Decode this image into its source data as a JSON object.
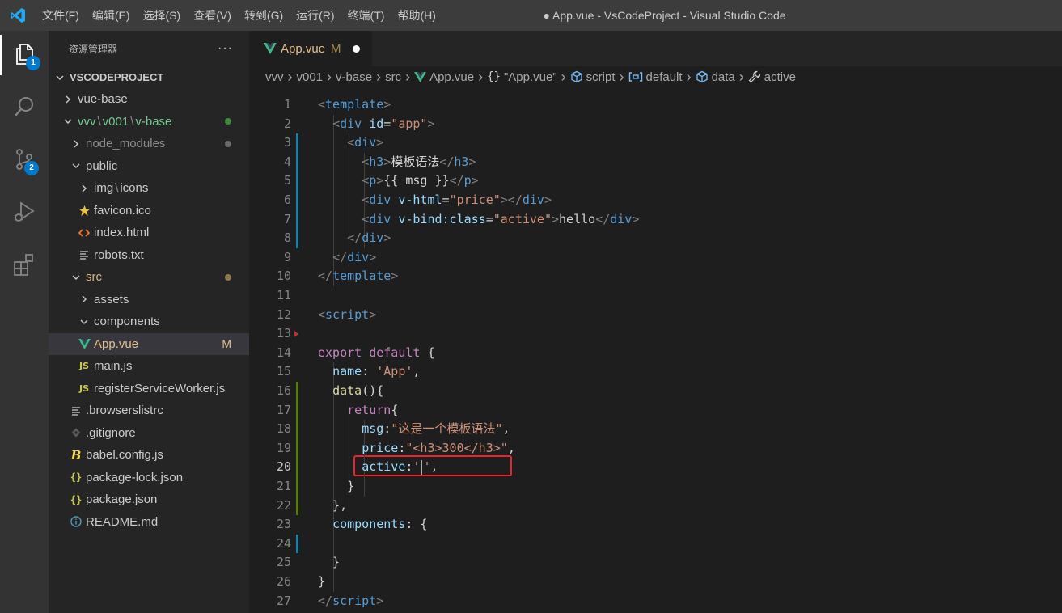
{
  "titlebar": {
    "menu": [
      "文件(F)",
      "编辑(E)",
      "选择(S)",
      "查看(V)",
      "转到(G)",
      "运行(R)",
      "终端(T)",
      "帮助(H)"
    ],
    "window_title": "● App.vue - VsCodeProject - Visual Studio Code"
  },
  "activitybar": {
    "items": [
      {
        "icon": "files-icon",
        "badge": "1"
      },
      {
        "icon": "search-icon"
      },
      {
        "icon": "source-control-icon",
        "badge": "2"
      },
      {
        "icon": "run-debug-icon"
      },
      {
        "icon": "extensions-icon"
      }
    ]
  },
  "sidebar": {
    "title": "资源管理器",
    "more": "···",
    "root": "VSCODEPROJECT",
    "tree": [
      {
        "label": "vue-base",
        "chev": "right",
        "indent": 1
      },
      {
        "label": "vvv",
        "path": [
          "v001",
          "v-base"
        ],
        "chev": "down",
        "indent": 1,
        "color": "#73c991",
        "dot": "#3c8a3c"
      },
      {
        "label": "node_modules",
        "chev": "right",
        "indent": 2,
        "color": "#8c8c8c",
        "dot": "#6b6b6b"
      },
      {
        "label": "public",
        "chev": "down",
        "indent": 2
      },
      {
        "label": "img",
        "path": [
          "icons"
        ],
        "chev": "right",
        "indent": 3
      },
      {
        "label": "favicon.ico",
        "icon": "star-icon",
        "indent": 3
      },
      {
        "label": "index.html",
        "icon": "html-icon",
        "indent": 3
      },
      {
        "label": "robots.txt",
        "icon": "text-lines-icon",
        "indent": 3
      },
      {
        "label": "src",
        "chev": "down",
        "indent": 2,
        "color": "#d7ba7d",
        "dot": "#8c7a4a"
      },
      {
        "label": "assets",
        "chev": "right",
        "indent": 3
      },
      {
        "label": "components",
        "chev": "down",
        "indent": 3
      },
      {
        "label": "App.vue",
        "icon": "vue-icon",
        "indent": 3,
        "color": "#e2c08d",
        "deco": "M",
        "selected": true
      },
      {
        "label": "main.js",
        "icon": "js-icon",
        "indent": 3
      },
      {
        "label": "registerServiceWorker.js",
        "icon": "js-icon",
        "indent": 3
      },
      {
        "label": ".browserslistrc",
        "icon": "text-lines-icon",
        "indent": 2
      },
      {
        "label": ".gitignore",
        "icon": "git-icon",
        "indent": 2
      },
      {
        "label": "babel.config.js",
        "icon": "babel-icon",
        "indent": 2
      },
      {
        "label": "package-lock.json",
        "icon": "json-icon",
        "indent": 2
      },
      {
        "label": "package.json",
        "icon": "json-icon",
        "indent": 2
      },
      {
        "label": "README.md",
        "icon": "info-icon",
        "indent": 2
      }
    ]
  },
  "tab": {
    "label": "App.vue",
    "status": "M"
  },
  "breadcrumbs": [
    {
      "label": "vvv"
    },
    {
      "label": "v001"
    },
    {
      "label": "v-base"
    },
    {
      "label": "src"
    },
    {
      "label": "App.vue",
      "icon": "vue-icon"
    },
    {
      "label": "\"App.vue\"",
      "icon": "braces-icon"
    },
    {
      "label": "script",
      "icon": "cube-icon"
    },
    {
      "label": "default",
      "icon": "brackets-icon"
    },
    {
      "label": "data",
      "icon": "cube-icon"
    },
    {
      "label": "active",
      "icon": "wrench-icon"
    }
  ],
  "code": {
    "current_line": 20,
    "lines": [
      {
        "n": "1",
        "t": [
          [
            "t-punc",
            "<"
          ],
          [
            "t-tag",
            "template"
          ],
          [
            "t-punc",
            ">"
          ]
        ]
      },
      {
        "n": "2",
        "t": [
          [
            "t-text",
            "  "
          ],
          [
            "t-punc",
            "<"
          ],
          [
            "t-tag",
            "div"
          ],
          [
            "t-text",
            " "
          ],
          [
            "t-attr",
            "id"
          ],
          [
            "t-text",
            "="
          ],
          [
            "t-str",
            "\"app\""
          ],
          [
            "t-punc",
            ">"
          ]
        ]
      },
      {
        "n": "3",
        "t": [
          [
            "t-text",
            "    "
          ],
          [
            "t-punc",
            "<"
          ],
          [
            "t-tag",
            "div"
          ],
          [
            "t-punc",
            ">"
          ]
        ]
      },
      {
        "n": "4",
        "t": [
          [
            "t-text",
            "      "
          ],
          [
            "t-punc",
            "<"
          ],
          [
            "t-tag",
            "h3"
          ],
          [
            "t-punc",
            ">"
          ],
          [
            "t-text",
            "模板语法"
          ],
          [
            "t-punc",
            "</"
          ],
          [
            "t-tag",
            "h3"
          ],
          [
            "t-punc",
            ">"
          ]
        ]
      },
      {
        "n": "5",
        "t": [
          [
            "t-text",
            "      "
          ],
          [
            "t-punc",
            "<"
          ],
          [
            "t-tag",
            "p"
          ],
          [
            "t-punc",
            ">"
          ],
          [
            "t-text",
            "{{ msg }}"
          ],
          [
            "t-punc",
            "</"
          ],
          [
            "t-tag",
            "p"
          ],
          [
            "t-punc",
            ">"
          ]
        ]
      },
      {
        "n": "6",
        "t": [
          [
            "t-text",
            "      "
          ],
          [
            "t-punc",
            "<"
          ],
          [
            "t-tag",
            "div"
          ],
          [
            "t-text",
            " "
          ],
          [
            "t-attr",
            "v-html"
          ],
          [
            "t-text",
            "="
          ],
          [
            "t-str",
            "\"price\""
          ],
          [
            "t-punc",
            "></"
          ],
          [
            "t-tag",
            "div"
          ],
          [
            "t-punc",
            ">"
          ]
        ]
      },
      {
        "n": "7",
        "t": [
          [
            "t-text",
            "      "
          ],
          [
            "t-punc",
            "<"
          ],
          [
            "t-tag",
            "div"
          ],
          [
            "t-text",
            " "
          ],
          [
            "t-attr",
            "v-bind:class"
          ],
          [
            "t-text",
            "="
          ],
          [
            "t-str",
            "\"active\""
          ],
          [
            "t-punc",
            ">"
          ],
          [
            "t-text",
            "hello"
          ],
          [
            "t-punc",
            "</"
          ],
          [
            "t-tag",
            "div"
          ],
          [
            "t-punc",
            ">"
          ]
        ]
      },
      {
        "n": "8",
        "t": [
          [
            "t-text",
            "    "
          ],
          [
            "t-punc",
            "</"
          ],
          [
            "t-tag",
            "div"
          ],
          [
            "t-punc",
            ">"
          ]
        ]
      },
      {
        "n": "9",
        "t": [
          [
            "t-text",
            "  "
          ],
          [
            "t-punc",
            "</"
          ],
          [
            "t-tag",
            "div"
          ],
          [
            "t-punc",
            ">"
          ]
        ]
      },
      {
        "n": "10",
        "t": [
          [
            "t-punc",
            "</"
          ],
          [
            "t-tag",
            "template"
          ],
          [
            "t-punc",
            ">"
          ]
        ]
      },
      {
        "n": "11",
        "t": []
      },
      {
        "n": "12",
        "t": [
          [
            "t-punc",
            "<"
          ],
          [
            "t-tag",
            "script"
          ],
          [
            "t-punc",
            ">"
          ]
        ]
      },
      {
        "n": "13",
        "t": []
      },
      {
        "n": "14",
        "t": [
          [
            "t-kw",
            "export"
          ],
          [
            "t-text",
            " "
          ],
          [
            "t-kw",
            "default"
          ],
          [
            "t-text",
            " {"
          ]
        ]
      },
      {
        "n": "15",
        "t": [
          [
            "t-text",
            "  "
          ],
          [
            "t-prop",
            "name"
          ],
          [
            "t-text",
            ": "
          ],
          [
            "t-str",
            "'App'"
          ],
          [
            "t-text",
            ","
          ]
        ]
      },
      {
        "n": "16",
        "t": [
          [
            "t-text",
            "  "
          ],
          [
            "t-fn",
            "data"
          ],
          [
            "t-text",
            "(){"
          ]
        ]
      },
      {
        "n": "17",
        "t": [
          [
            "t-text",
            "    "
          ],
          [
            "t-kw",
            "return"
          ],
          [
            "t-text",
            "{"
          ]
        ]
      },
      {
        "n": "18",
        "t": [
          [
            "t-text",
            "      "
          ],
          [
            "t-prop",
            "msg"
          ],
          [
            "t-text",
            ":"
          ],
          [
            "t-str",
            "\"这是一个模板语法\""
          ],
          [
            "t-text",
            ","
          ]
        ]
      },
      {
        "n": "19",
        "t": [
          [
            "t-text",
            "      "
          ],
          [
            "t-prop",
            "price"
          ],
          [
            "t-text",
            ":"
          ],
          [
            "t-str",
            "\"<h3>300</h3>\""
          ],
          [
            "t-text",
            ","
          ]
        ]
      },
      {
        "n": "20",
        "t": [
          [
            "t-text",
            "      "
          ],
          [
            "t-prop",
            "active"
          ],
          [
            "t-text",
            ":"
          ],
          [
            "t-str",
            "'"
          ],
          [
            "cursor",
            ""
          ],
          [
            "t-str",
            "'"
          ],
          [
            "t-text",
            ","
          ]
        ]
      },
      {
        "n": "21",
        "t": [
          [
            "t-text",
            "    }"
          ]
        ]
      },
      {
        "n": "22",
        "t": [
          [
            "t-text",
            "  },"
          ]
        ]
      },
      {
        "n": "23",
        "t": [
          [
            "t-text",
            "  "
          ],
          [
            "t-prop",
            "components"
          ],
          [
            "t-text",
            ": {"
          ]
        ]
      },
      {
        "n": "24",
        "t": []
      },
      {
        "n": "25",
        "t": [
          [
            "t-text",
            "  }"
          ]
        ]
      },
      {
        "n": "26",
        "t": [
          [
            "t-text",
            "}"
          ]
        ]
      },
      {
        "n": "27",
        "t": [
          [
            "t-punc",
            "</"
          ],
          [
            "t-tag",
            "script"
          ],
          [
            "t-punc",
            ">"
          ]
        ]
      }
    ]
  },
  "colors": {
    "accent": "#007acc",
    "highlight_box": "#e5262d",
    "vue_green": "#41b883",
    "gutter_modified": "#1b81a8",
    "gutter_added": "#587c0c"
  }
}
